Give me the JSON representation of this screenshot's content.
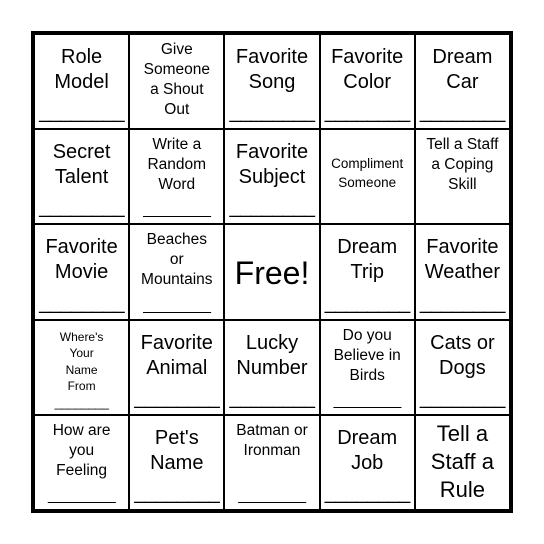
{
  "card": {
    "cells": [
      {
        "text": "Role\nModel",
        "size": "xl",
        "blank": "________"
      },
      {
        "text": "Give\nSomeone\na Shout\nOut",
        "size": "md",
        "blank": ""
      },
      {
        "text": "Favorite\nSong",
        "size": "xl",
        "blank": "________"
      },
      {
        "text": "Favorite\nColor",
        "size": "xl",
        "blank": "________"
      },
      {
        "text": "Dream\nCar",
        "size": "xl",
        "blank": "________"
      },
      {
        "text": "Secret\nTalent",
        "size": "xl",
        "blank": "________"
      },
      {
        "text": "Write a\nRandom\nWord",
        "size": "md",
        "blank": "________"
      },
      {
        "text": "Favorite\nSubject",
        "size": "xl",
        "blank": "________"
      },
      {
        "text": "Compliment\nSomeone",
        "size": "sm",
        "blank": ""
      },
      {
        "text": "Tell a Staff\na Coping\nSkill",
        "size": "md",
        "blank": ""
      },
      {
        "text": "Favorite\nMovie",
        "size": "xl",
        "blank": "________"
      },
      {
        "text": "Beaches\nor\nMountains",
        "size": "md",
        "blank": "________"
      },
      {
        "text": "Free!",
        "size": "free",
        "blank": ""
      },
      {
        "text": "Dream\nTrip",
        "size": "xl",
        "blank": "________"
      },
      {
        "text": "Favorite\nWeather",
        "size": "xl",
        "blank": "________"
      },
      {
        "text": "Where's\nYour\nName\nFrom",
        "size": "xs",
        "blank": "________"
      },
      {
        "text": "Favorite\nAnimal",
        "size": "xl",
        "blank": "________"
      },
      {
        "text": "Lucky\nNumber",
        "size": "xl",
        "blank": "________"
      },
      {
        "text": "Do you\nBelieve in\nBirds",
        "size": "md",
        "blank": "________"
      },
      {
        "text": "Cats or\nDogs",
        "size": "xl",
        "blank": "________"
      },
      {
        "text": "How are\nyou\nFeeling",
        "size": "md",
        "blank": "________"
      },
      {
        "text": "Pet's\nName",
        "size": "xl",
        "blank": "________"
      },
      {
        "text": "Batman or\nIronman",
        "size": "md",
        "blank": "________"
      },
      {
        "text": "Dream\nJob",
        "size": "xl",
        "blank": "________"
      },
      {
        "text": "Tell a\nStaff a\nRule",
        "size": "big",
        "blank": ""
      }
    ]
  }
}
